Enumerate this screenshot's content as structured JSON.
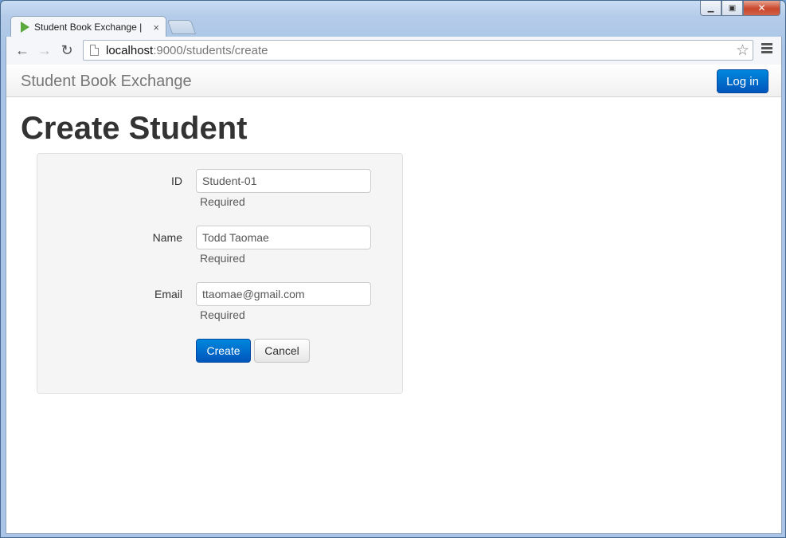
{
  "browser": {
    "tab_title": "Student Book Exchange | Cre",
    "tab_close": "×",
    "back": "←",
    "forward": "→",
    "reload": "↻",
    "url_host": "localhost",
    "url_path": ":9000/students/create",
    "star": "☆",
    "win_minimize": "▁",
    "win_maximize": "▣",
    "win_close": "✕"
  },
  "navbar": {
    "brand": "Student Book Exchange",
    "login_label": "Log in"
  },
  "page": {
    "title": "Create Student"
  },
  "form": {
    "fields": [
      {
        "label": "ID",
        "value": "Student-01",
        "help": "Required"
      },
      {
        "label": "Name",
        "value": "Todd Taomae",
        "help": "Required"
      },
      {
        "label": "Email",
        "value": "ttaomae@gmail.com",
        "help": "Required"
      }
    ],
    "create_label": "Create",
    "cancel_label": "Cancel"
  }
}
